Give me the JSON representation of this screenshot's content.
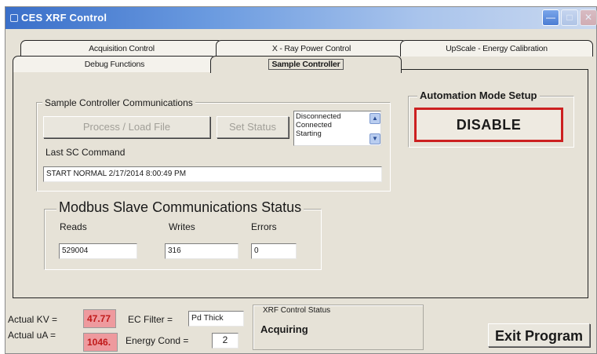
{
  "window": {
    "title": "CES XRF Control",
    "title_color": "#ffffff",
    "titlebar_color": "#3a6fc9"
  },
  "tabs": {
    "row_back": [
      "Acquisition Control",
      "X - Ray Power Control",
      "UpScale - Energy Calibration"
    ],
    "row_front": [
      "Debug Functions",
      "Sample Controller"
    ],
    "active": "Sample Controller"
  },
  "sc_comm": {
    "title": "Sample Controller Communications",
    "process_button": "Process / Load File",
    "set_status_button": "Set Status",
    "status_options": [
      "Disconnected",
      "Connected",
      "Starting"
    ],
    "last_cmd_label": "Last SC Command",
    "last_cmd_value": "START NORMAL   2/17/2014 8:00:49 PM"
  },
  "modbus": {
    "title": "Modbus Slave Communications  Status",
    "reads_label": "Reads",
    "writes_label": "Writes",
    "errors_label": "Errors",
    "reads_value": "529004",
    "writes_value": "316",
    "errors_value": "0"
  },
  "automation": {
    "title": "Automation Mode Setup",
    "button": "DISABLE",
    "highlight_color": "#cc2020"
  },
  "status_bar": {
    "kv_label": "Actual KV =",
    "kv_value": "47.77",
    "ua_label": "Actual uA =",
    "ua_value": "1046.",
    "ec_filter_label": "EC Filter =",
    "ec_filter_value": "Pd Thick",
    "energy_cond_label": "Energy Cond =",
    "energy_cond_value": "2",
    "xrf_status_title": "XRF Control Status",
    "xrf_status_value": "Acquiring",
    "exit_button": "Exit Program",
    "value_box_color": "#ee9a9e"
  }
}
